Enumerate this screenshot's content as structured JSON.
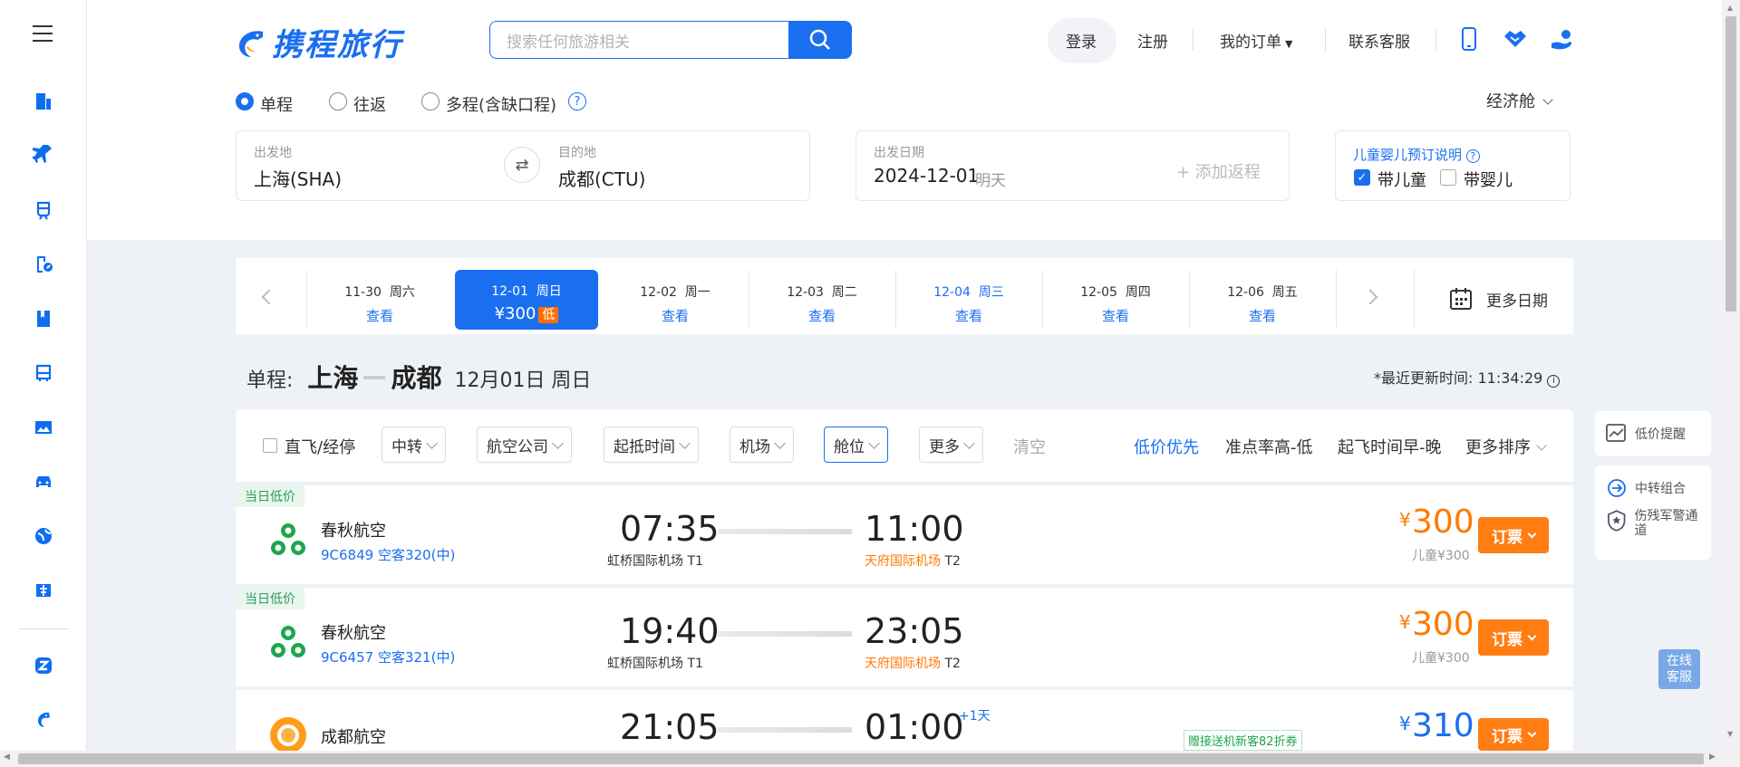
{
  "brand": {
    "name": "携程旅行"
  },
  "search": {
    "placeholder": "搜索任何旅游相关"
  },
  "nav": {
    "login": "登录",
    "register": "注册",
    "orders": "我的订单",
    "service": "联系客服"
  },
  "trip": {
    "oneway": "单程",
    "roundtrip": "往返",
    "multi": "多程(含缺口程)",
    "cabin": "经济舱"
  },
  "route": {
    "from_label": "出发地",
    "from_value": "上海(SHA)",
    "to_label": "目的地",
    "to_value": "成都(CTU)",
    "date_label": "出发日期",
    "date_value": "2024-12-01",
    "date_hint": "明天",
    "add_return": "+ 添加返程"
  },
  "kids": {
    "title": "儿童婴儿预订说明",
    "child": "带儿童",
    "infant": "带婴儿"
  },
  "dates": [
    {
      "d": "11-30",
      "w": "周六",
      "l": "查看"
    },
    {
      "d": "12-01",
      "w": "周日",
      "l": "¥300",
      "badge": "低"
    },
    {
      "d": "12-02",
      "w": "周一",
      "l": "查看"
    },
    {
      "d": "12-03",
      "w": "周二",
      "l": "查看"
    },
    {
      "d": "12-04",
      "w": "周三",
      "l": "查看"
    },
    {
      "d": "12-05",
      "w": "周四",
      "l": "查看"
    },
    {
      "d": "12-06",
      "w": "周五",
      "l": "查看"
    }
  ],
  "more_dates": "更多日期",
  "heading": {
    "prefix": "单程:",
    "from": "上海",
    "to": "成都",
    "date": "12月01日 周日",
    "update": "*最近更新时间: 11:34:29"
  },
  "filters": {
    "direct": "直飞/经停",
    "transfer": "中转",
    "airline": "航空公司",
    "times": "起抵时间",
    "airport": "机场",
    "cabin": "舱位",
    "more": "更多",
    "clear": "清空"
  },
  "sorts": {
    "low": "低价优先",
    "ontime": "准点率高-低",
    "depart": "起飞时间早-晚",
    "more": "更多排序"
  },
  "flights": [
    {
      "tag": "当日低价",
      "airline": "春秋航空",
      "code": "9C6849 空客320(中)",
      "dep": "07:35",
      "arr": "11:00",
      "dep_ap": "虹桥国际机场",
      "dep_t": "T1",
      "arr_ap": "天府国际机场",
      "arr_t": "T2",
      "price": "300",
      "child": "儿童¥300",
      "book": "订票"
    },
    {
      "tag": "当日低价",
      "airline": "春秋航空",
      "code": "9C6457 空客321(中)",
      "dep": "19:40",
      "arr": "23:05",
      "dep_ap": "虹桥国际机场",
      "dep_t": "T1",
      "arr_ap": "天府国际机场",
      "arr_t": "T2",
      "price": "300",
      "child": "儿童¥300",
      "book": "订票"
    },
    {
      "airline": "成都航空",
      "dep": "21:05",
      "arr": "01:00",
      "plus": "+1天",
      "promo": "赠接送机新客82折券",
      "price": "310",
      "book": "订票"
    }
  ],
  "side": {
    "alert": "低价提醒",
    "combo": "中转组合",
    "veteran": "伤残军警通道",
    "online": "在线客服"
  },
  "colors": {
    "primary": "#1a6ff0",
    "orange": "#ff7a00",
    "green": "#1fa64a"
  }
}
